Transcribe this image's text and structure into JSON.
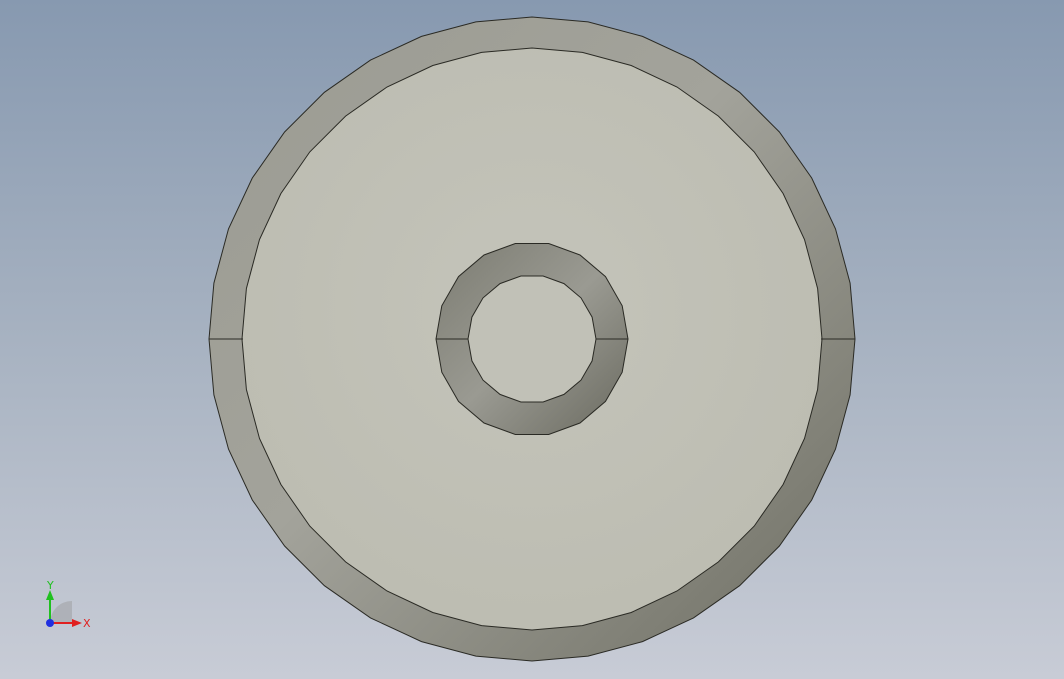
{
  "viewport": {
    "background_top": "#8799b0",
    "background_bottom": "#c8ccd6"
  },
  "model": {
    "description_shape": "washer",
    "outer_rim_color": "#8f8f86",
    "face_color": "#c1c1b7",
    "bore_wall_color": "#8a8a80",
    "edge_color": "#2a2a24"
  },
  "triad": {
    "x_label": "X",
    "y_label": "Y",
    "x_color": "#e02020",
    "y_color": "#20c020",
    "z_color": "#2030e0"
  }
}
